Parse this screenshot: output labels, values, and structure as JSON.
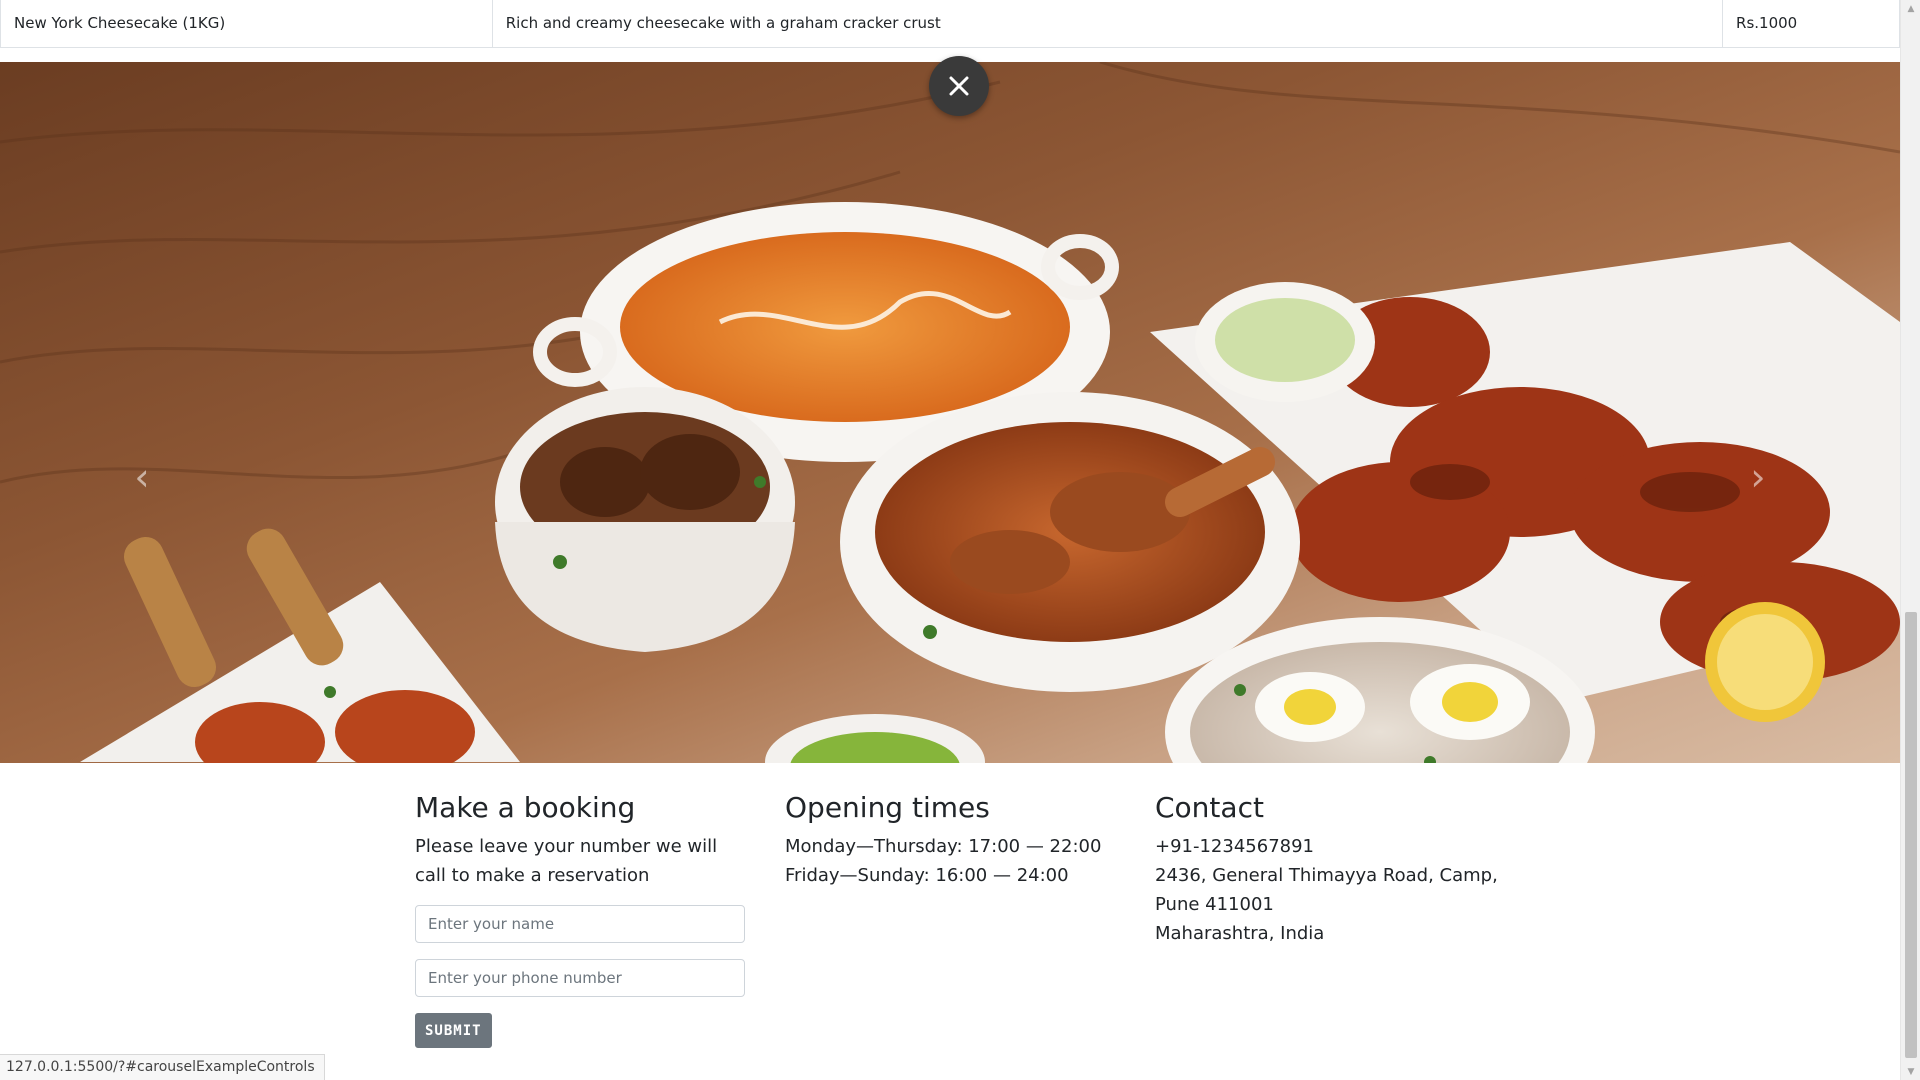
{
  "menu": {
    "row": {
      "name": "New York Cheesecake (1KG)",
      "description": "Rich and creamy cheesecake with a graham cracker crust",
      "price": "Rs.1000"
    }
  },
  "carousel": {
    "prev_icon": "chevron-left-icon",
    "next_icon": "chevron-right-icon",
    "close_icon": "close-icon"
  },
  "booking": {
    "title": "Make a booking",
    "text": "Please leave your number we will call to make a reservation",
    "name_placeholder": "Enter your name",
    "phone_placeholder": "Enter your phone number",
    "submit_label": "SUBMIT"
  },
  "hours": {
    "title": "Opening times",
    "lines": [
      "Monday—Thursday: 17:00 — 22:00",
      "Friday—Sunday: 16:00 — 24:00"
    ]
  },
  "contact": {
    "title": "Contact",
    "phone": "+91-1234567891",
    "address_line1": "2436, General Thimayya Road, Camp, Pune 411001",
    "address_line2": "Maharashtra, India"
  },
  "status_bar": {
    "url": "127.0.0.1:5500/?#carouselExampleControls"
  },
  "colors": {
    "button_grey": "#6c757d",
    "close_button": "#3a3a3a",
    "table_border": "#dee2e6"
  }
}
